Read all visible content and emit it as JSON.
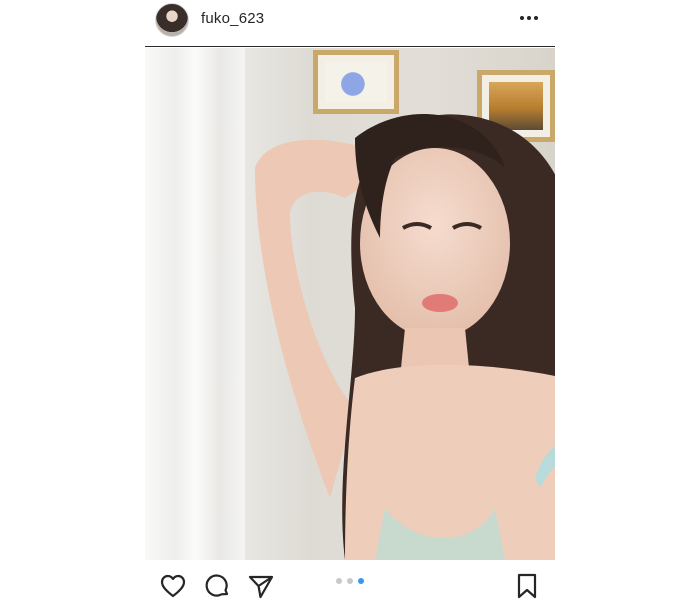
{
  "post": {
    "username": "fuko_623",
    "icons": {
      "avatar": "profile-avatar",
      "more": "more-options-icon",
      "like": "heart-icon",
      "comment": "comment-icon",
      "share": "send-icon",
      "save": "bookmark-icon"
    },
    "carousel": {
      "total": 3,
      "active_index": 2
    },
    "colors": {
      "text": "#262626",
      "active_dot": "#3897f0",
      "inactive_dot": "#c8c8c8"
    }
  }
}
